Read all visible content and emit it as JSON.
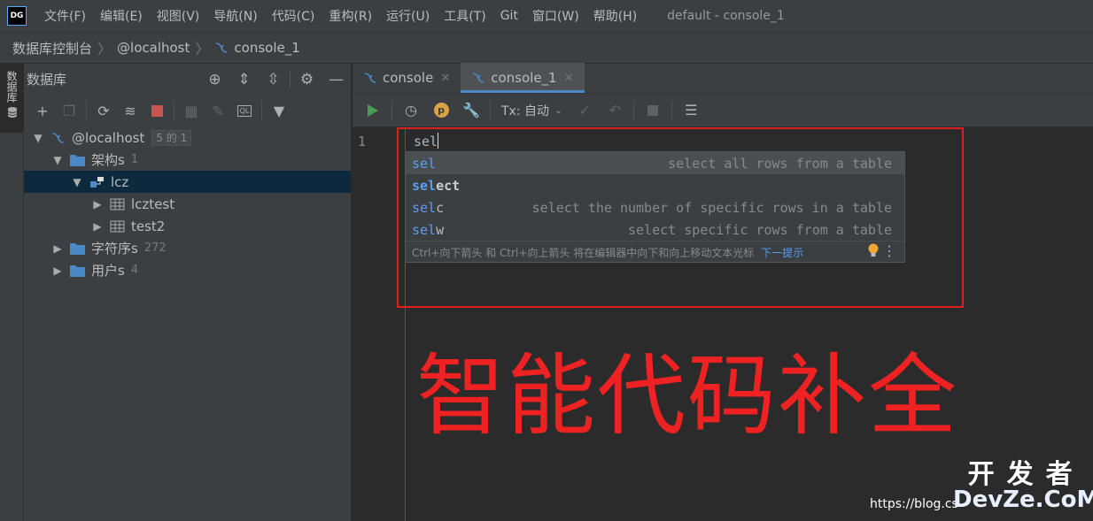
{
  "app": {
    "logo_text": "DG",
    "window_title": "default - console_1"
  },
  "menu": [
    "文件(F)",
    "编辑(E)",
    "视图(V)",
    "导航(N)",
    "代码(C)",
    "重构(R)",
    "运行(U)",
    "工具(T)",
    "Git",
    "窗口(W)",
    "帮助(H)"
  ],
  "breadcrumb": {
    "items": [
      "数据库控制台",
      "@localhost",
      "console_1"
    ]
  },
  "left_strip": {
    "tab_label": "数据库"
  },
  "db_panel": {
    "title": "数据库",
    "tree": {
      "root": {
        "label": "@localhost",
        "badge": "5 的 1"
      },
      "schemas": {
        "label": "架构s",
        "count": "1"
      },
      "schema": {
        "label": "lcz"
      },
      "tables": [
        "lcztest",
        "test2"
      ],
      "collations": {
        "label": "字符序s",
        "count": "272"
      },
      "users": {
        "label": "用户s",
        "count": "4"
      }
    }
  },
  "editor": {
    "tabs": [
      {
        "label": "console",
        "active": false
      },
      {
        "label": "console_1",
        "active": true
      }
    ],
    "toolbar": {
      "tx_label": "Tx: 自动"
    },
    "line_number": "1",
    "code_text": "sel",
    "completion": {
      "typed_prefix": "sel",
      "items": [
        {
          "name_rest": "",
          "desc": "select all rows from a table",
          "bold": false,
          "selected": true
        },
        {
          "name_rest": "ect",
          "desc": "",
          "bold": true,
          "selected": false
        },
        {
          "name_rest": "c",
          "desc": "select the number of specific rows in a table",
          "bold": false,
          "selected": false
        },
        {
          "name_rest": "w",
          "desc": "select specific rows from a table",
          "bold": false,
          "selected": false
        }
      ],
      "footer_text": "Ctrl+向下箭头 和 Ctrl+向上箭头 将在编辑器中向下和向上移动文本光标",
      "footer_link": "下一提示"
    }
  },
  "annotation": {
    "caption": "智能代码补全",
    "color": "#ee2222"
  },
  "watermark": {
    "url": "https://blog.cs",
    "brand_cn": "开发者",
    "brand_en": "DevZe.CoM"
  },
  "colors": {
    "accent": "#4a88c7",
    "match": "#589df6",
    "selection": "#0d293e",
    "run_green": "#499c54"
  }
}
